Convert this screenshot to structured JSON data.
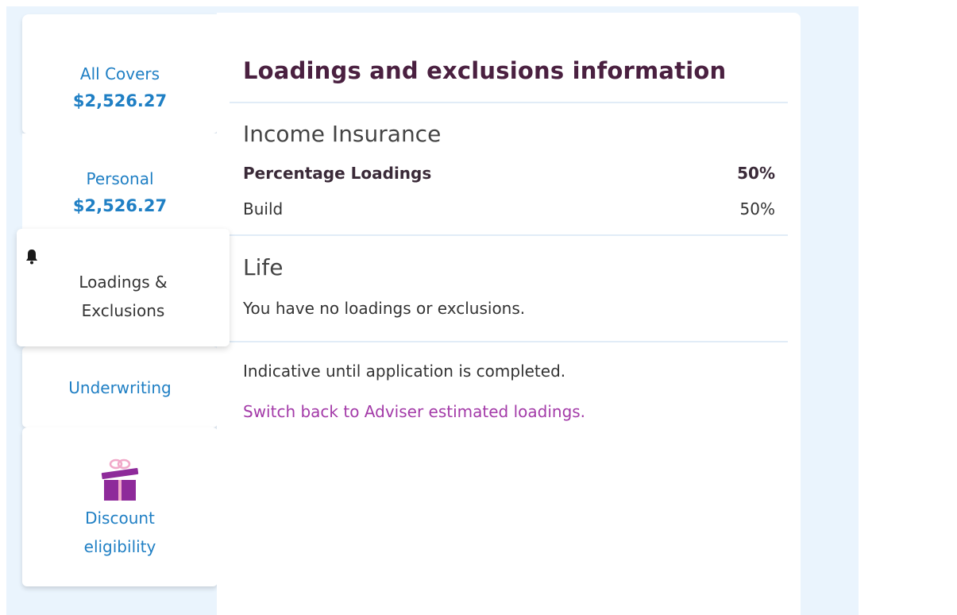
{
  "tabs": {
    "all_covers": {
      "label": "All Covers",
      "amount": "$2,526.27"
    },
    "personal": {
      "label": "Personal",
      "amount": "$2,526.27"
    },
    "loadings": {
      "label": "Loadings & Exclusions",
      "icon": "bell-icon"
    },
    "underwriting": {
      "label": "Underwriting"
    },
    "discount": {
      "label": "Discount eligibility",
      "icon": "gift-icon"
    }
  },
  "panel": {
    "title": "Loadings and exclusions information",
    "income_insurance": {
      "title": "Income Insurance",
      "rows": [
        {
          "label": "Percentage Loadings",
          "value": "50%"
        },
        {
          "label": "Build",
          "value": "50%"
        }
      ]
    },
    "life": {
      "title": "Life",
      "message": "You have no loadings or exclusions."
    },
    "footer_note": "Indicative until application is completed.",
    "switch_link": "Switch back to Adviser estimated loadings."
  },
  "colors": {
    "background": "#eaf4fd",
    "tab_text": "#1f7fc4",
    "title": "#4a2040",
    "link": "#a33aa8",
    "gift": "#8e2a9a"
  }
}
